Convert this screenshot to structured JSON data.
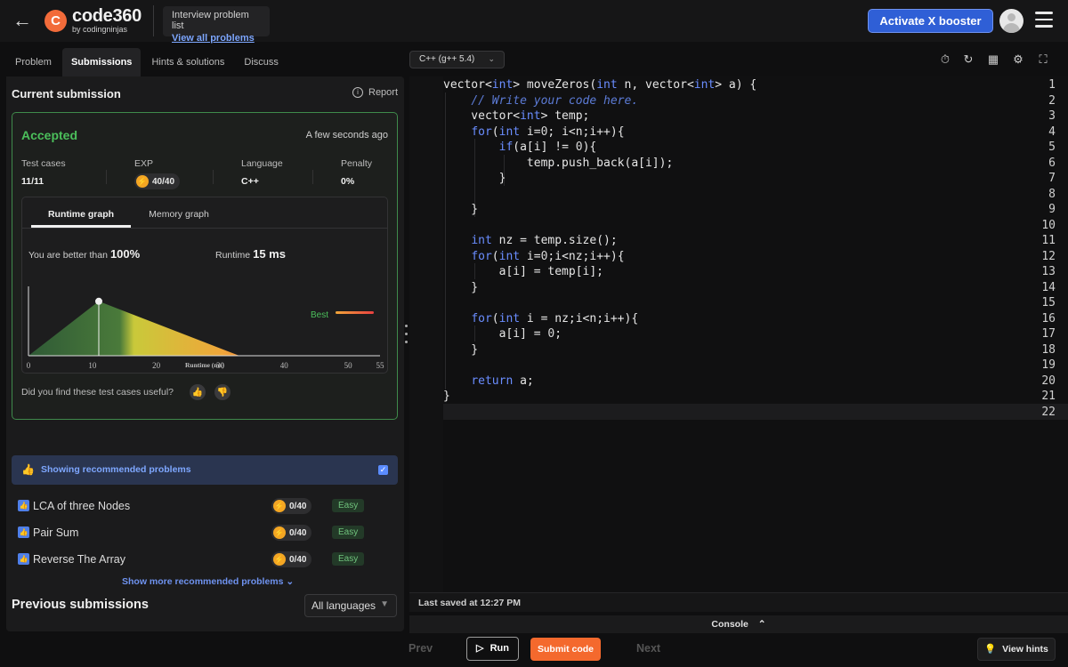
{
  "header": {
    "logo_main": "code360",
    "logo_sub": "by codingninjas",
    "breadcrumb_title": "Interview problem list",
    "breadcrumb_link": "View all problems",
    "activate_label": "Activate X booster"
  },
  "tabs": [
    {
      "label": "Problem"
    },
    {
      "label": "Submissions"
    },
    {
      "label": "Hints & solutions"
    },
    {
      "label": "Discuss"
    }
  ],
  "submission": {
    "title": "Current submission",
    "report_label": "Report",
    "status": "Accepted",
    "status_color": "#4bbf5b",
    "time": "A few seconds ago",
    "stats": {
      "test_cases_label": "Test cases",
      "test_cases_value": "11/11",
      "exp_label": "EXP",
      "exp_value": "40/40",
      "language_label": "Language",
      "language_value": "C++",
      "penalty_label": "Penalty",
      "penalty_value": "0%"
    },
    "graph_tabs": {
      "runtime": "Runtime graph",
      "memory": "Memory graph"
    },
    "better_label": "You are better than",
    "better_value": "100%",
    "runtime_label": "Runtime",
    "runtime_value": "15 ms",
    "best_label": "Best",
    "useful_question": "Did you find these test cases useful?"
  },
  "chart_data": {
    "type": "area",
    "xlabel": "Runtime (ms)",
    "ticks": [
      0,
      10,
      20,
      30,
      40,
      50,
      55
    ],
    "xlim": [
      0,
      55
    ],
    "x": [
      0,
      11,
      33,
      55
    ],
    "y": [
      0,
      0.9,
      0,
      0
    ],
    "marker_x": 11,
    "legend": "top-right"
  },
  "recommended": {
    "header": "Showing recommended problems",
    "items": [
      {
        "name": "LCA of three Nodes",
        "xp": "0/40",
        "difficulty": "Easy"
      },
      {
        "name": "Pair Sum",
        "xp": "0/40",
        "difficulty": "Easy"
      },
      {
        "name": "Reverse The Array",
        "xp": "0/40",
        "difficulty": "Easy"
      }
    ],
    "show_more": "Show more recommended problems"
  },
  "previous": {
    "title": "Previous submissions",
    "language_filter": "All languages"
  },
  "editor": {
    "language": "C++ (g++ 5.4)",
    "line_count": 22,
    "last_saved": "Last saved at 12:27 PM",
    "console_label": "Console"
  },
  "footer": {
    "prev": "Prev",
    "run": "Run",
    "submit": "Submit code",
    "next": "Next",
    "hints": "View hints"
  }
}
